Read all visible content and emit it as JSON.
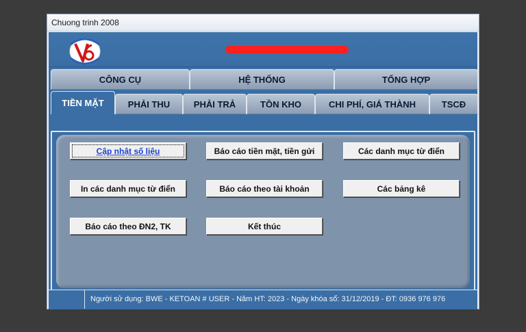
{
  "window": {
    "title": "Chuong trinh 2008"
  },
  "tabs_row1": [
    "CÔNG CỤ",
    "HỆ THỐNG",
    "TỔNG HỢP"
  ],
  "tabs_row2": [
    "TIỀN MẶT",
    "PHẢI THU",
    "PHẢI TRẢ",
    "TỒN KHO",
    "CHI PHÍ, GIÁ THÀNH",
    "TSCĐ"
  ],
  "active_tab": "TIỀN MẶT",
  "buttons": [
    "Cập nhật số liệu",
    "Báo cáo tiền mặt, tiền gửi",
    "Các danh mục từ điển",
    "In các danh mục từ điển",
    "Báo cáo theo tài khoản",
    "Các bảng kê",
    "Báo cáo theo ĐN2, TK",
    "Kết thúc"
  ],
  "status_text": "Người sử dụng: BWE - KETOAN # USER - Năm HT: 2023 - Ngày khóa sổ: 31/12/2019 - ĐT: 0936 976 976",
  "colors": {
    "accent": "#3a6ea5",
    "panel": "#7f93ab",
    "redaction": "#ff1f1f"
  },
  "icons": {
    "logo": "v6-logo-icon"
  }
}
